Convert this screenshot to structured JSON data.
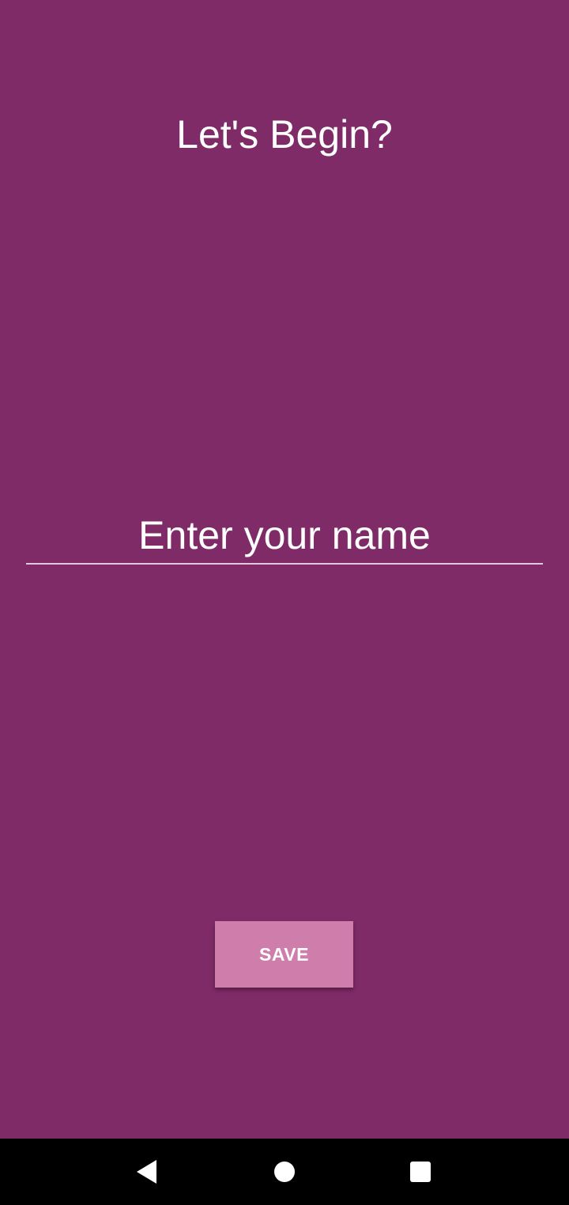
{
  "screen": {
    "title": "Let's Begin?",
    "background_color": "#7f2b67"
  },
  "name_field": {
    "placeholder": "Enter your name",
    "value": ""
  },
  "save_button": {
    "label": "SAVE",
    "color": "#cf7eab"
  },
  "nav_bar": {
    "back_icon": "back-triangle-icon",
    "home_icon": "home-circle-icon",
    "recents_icon": "recents-square-icon"
  }
}
